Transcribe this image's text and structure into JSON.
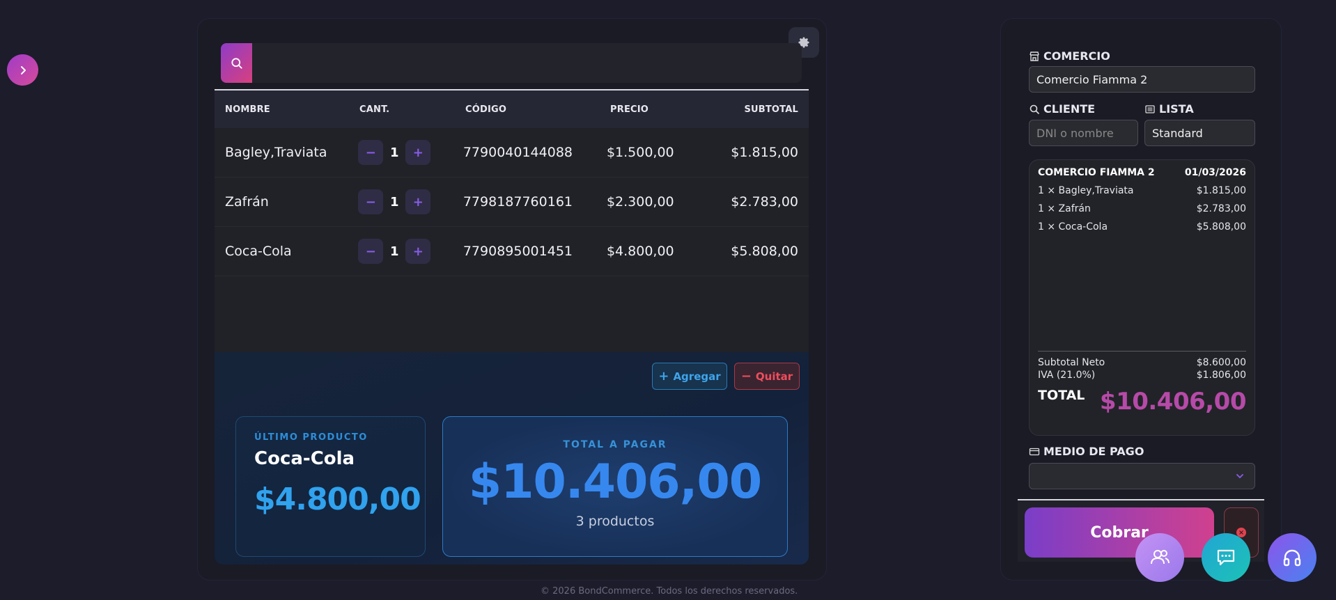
{
  "search": {
    "placeholder": ""
  },
  "table": {
    "headers": {
      "name": "NOMBRE",
      "qty": "CANT.",
      "code": "CÓDIGO",
      "price": "PRECIO",
      "subtotal": "SUBTOTAL"
    },
    "rows": [
      {
        "name": "Bagley,Traviata",
        "qty": "1",
        "code": "7790040144088",
        "price": "$1.500,00",
        "subtotal": "$1.815,00"
      },
      {
        "name": "Zafrán",
        "qty": "1",
        "code": "7798187760161",
        "price": "$2.300,00",
        "subtotal": "$2.783,00"
      },
      {
        "name": "Coca-Cola",
        "qty": "1",
        "code": "7790895001451",
        "price": "$4.800,00",
        "subtotal": "$5.808,00"
      }
    ],
    "minus": "−",
    "plus": "+"
  },
  "actions": {
    "add": "Agregar",
    "remove": "Quitar"
  },
  "last_product": {
    "label": "ÚLTIMO PRODUCTO",
    "name": "Coca-Cola",
    "price": "$4.800,00"
  },
  "total": {
    "label": "TOTAL A PAGAR",
    "amount": "$10.406,00",
    "count": "3 productos"
  },
  "footer": "© 2026 BondCommerce. Todos los derechos reservados.",
  "right": {
    "commerce_label": "COMERCIO",
    "commerce_value": "Comercio Fiamma 2",
    "client_label": "CLIENTE",
    "client_placeholder": "DNI o nombre",
    "list_label": "LISTA",
    "list_value": "Standard",
    "receipt": {
      "store": "COMERCIO FIAMMA 2",
      "date": "01/03/2026",
      "lines": [
        {
          "desc": "1 × Bagley,Traviata",
          "amount": "$1.815,00"
        },
        {
          "desc": "1 × Zafrán",
          "amount": "$2.783,00"
        },
        {
          "desc": "1 × Coca-Cola",
          "amount": "$5.808,00"
        }
      ],
      "subtotal_label": "Subtotal Neto",
      "subtotal_value": "$8.600,00",
      "iva_label": "IVA (21.0%)",
      "iva_value": "$1.806,00",
      "total_label": "TOTAL",
      "total_value": "$10.406,00"
    },
    "payment_label": "MEDIO DE PAGO",
    "payment_value": "",
    "charge_button": "Cobrar"
  },
  "colors": {
    "accent_purple": "#8a5ce8",
    "accent_blue": "#3688ef",
    "danger": "#ef4d5c",
    "brand_gradient_start": "#7a3ec8",
    "brand_gradient_end": "#d0408e"
  }
}
